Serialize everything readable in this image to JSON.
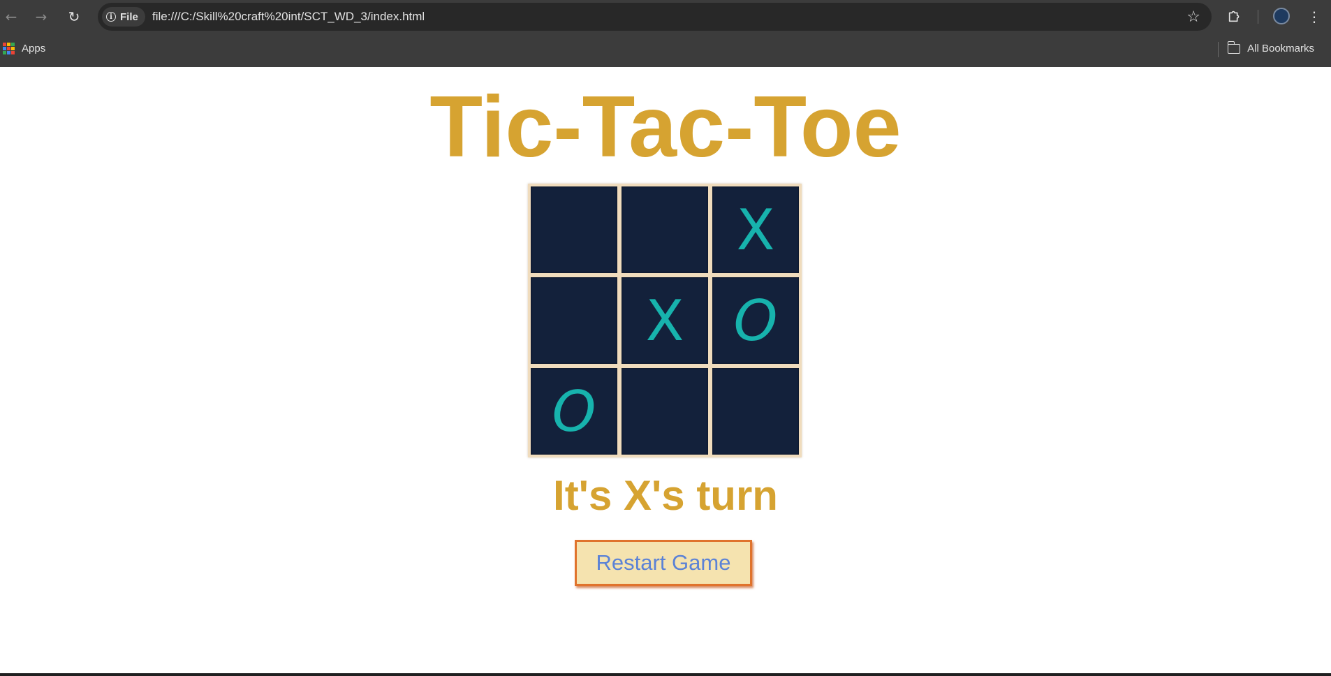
{
  "browser": {
    "site_chip_label": "File",
    "url": "file:///C:/Skill%20craft%20int/SCT_WD_3/index.html",
    "bookmarks": {
      "apps_label": "Apps",
      "all_bookmarks_label": "All Bookmarks"
    },
    "icons": [
      "back-arrow-icon",
      "forward-arrow-icon",
      "reload-icon",
      "info-icon",
      "star-icon",
      "extensions-icon",
      "profile-icon",
      "menu-icon",
      "apps-grid-icon",
      "folder-icon"
    ]
  },
  "game": {
    "title": "Tic-Tac-Toe",
    "board": [
      [
        "",
        "",
        "X"
      ],
      [
        "",
        "X",
        "O"
      ],
      [
        "O",
        "",
        ""
      ]
    ],
    "status": "It's X's turn",
    "restart_label": "Restart Game"
  },
  "colors": {
    "title": "#d6a331",
    "cell_background": "#13213b",
    "mark": "#17b3ad",
    "board_border": "#f0dcbd",
    "button_background": "#f5e3af",
    "button_border": "#e0732c",
    "button_text": "#5b82d6"
  }
}
